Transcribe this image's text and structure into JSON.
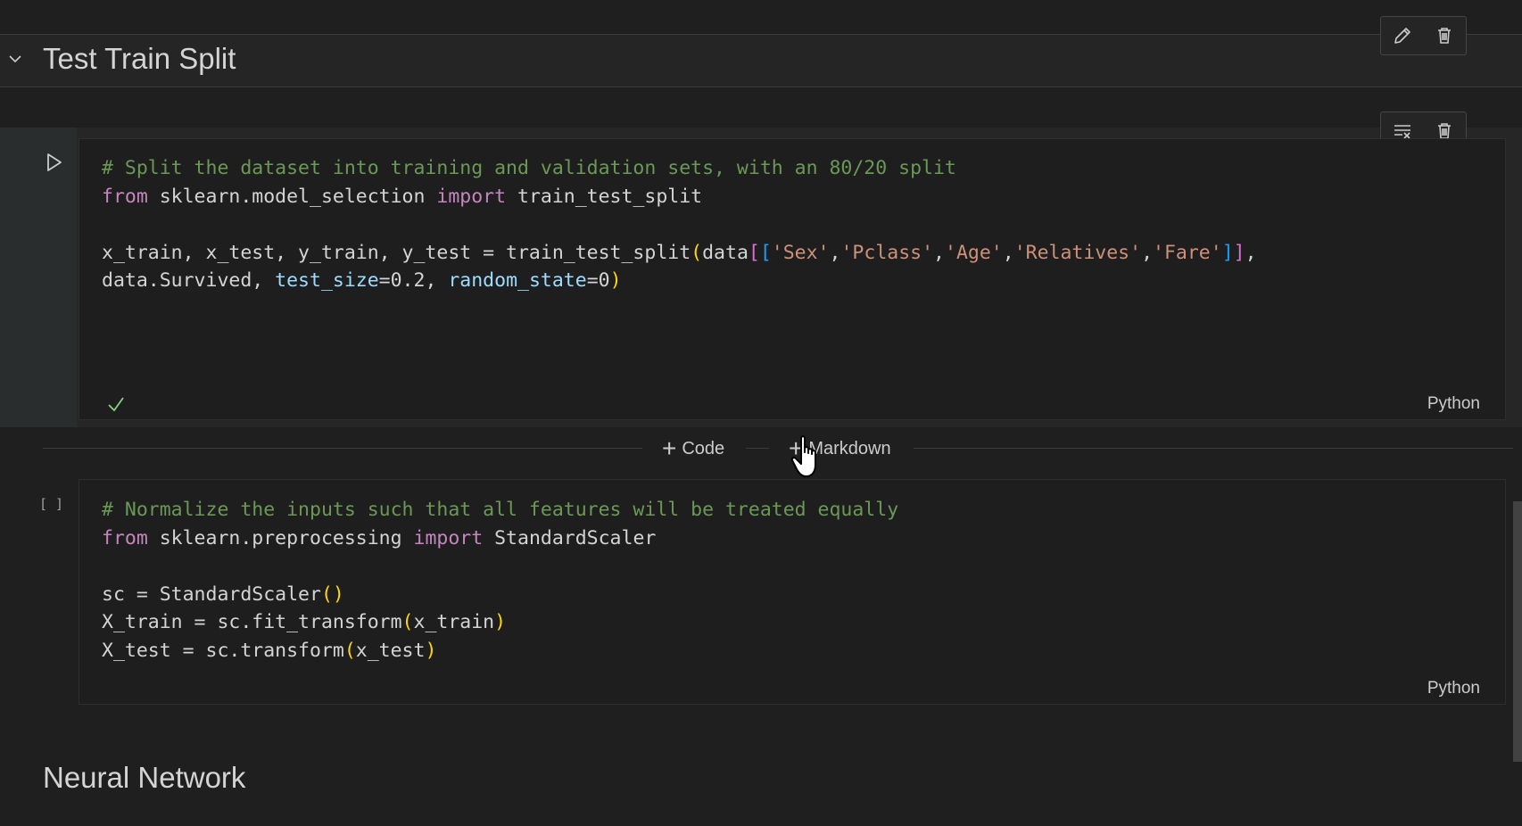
{
  "markdown_section": {
    "title": "Test Train Split"
  },
  "markdown_toolbar": {
    "edit_icon": "pencil-icon",
    "delete_icon": "trash-icon"
  },
  "code_toolbar": {
    "clear_output_icon": "clear-output-icon",
    "delete_icon": "trash-icon"
  },
  "cells": [
    {
      "language": "Python",
      "status": "success-checkmark",
      "lines": [
        "# Split the dataset into training and validation sets, with an 80/20 split",
        "from sklearn.model_selection import train_test_split",
        "",
        "x_train, x_test, y_train, y_test = train_test_split(data[['Sex','Pclass','Age','Relatives','Fare']],",
        "data.Survived, test_size=0.2, random_state=0)"
      ]
    },
    {
      "language": "Python",
      "execution_count": "[ ]",
      "lines": [
        "# Normalize the inputs such that all features will be treated equally",
        "from sklearn.preprocessing import StandardScaler",
        "",
        "sc = StandardScaler()",
        "X_train = sc.fit_transform(x_train)",
        "X_test = sc.transform(x_test)"
      ]
    }
  ],
  "add_cell": {
    "code_label": "Code",
    "markdown_label": "Markdown"
  },
  "next_section": {
    "title": "Neural Network"
  },
  "colors": {
    "background": "#1f1f1f",
    "comment": "#6a9955",
    "keyword": "#c586c0",
    "string": "#ce9178",
    "parameter": "#9cdcfe",
    "bracket": "#ffd700"
  }
}
